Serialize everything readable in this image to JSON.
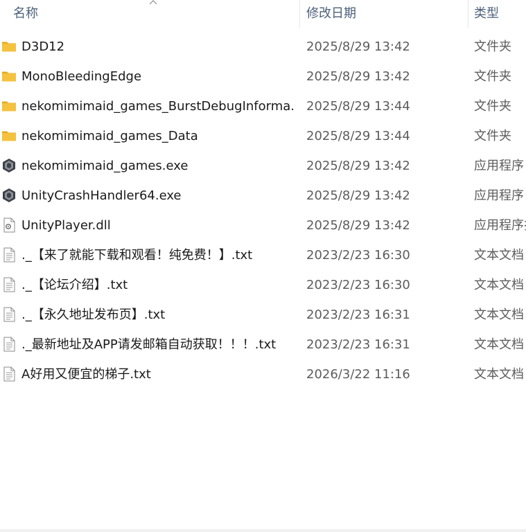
{
  "header": {
    "name_label": "名称",
    "date_label": "修改日期",
    "type_label": "类型",
    "sort_indicator": "sort-ascending-icon"
  },
  "files": [
    {
      "name": "D3D12",
      "date": "2025/8/29 13:42",
      "type": "文件夹",
      "icon": "folder-icon"
    },
    {
      "name": "MonoBleedingEdge",
      "date": "2025/8/29 13:42",
      "type": "文件夹",
      "icon": "folder-icon"
    },
    {
      "name": "nekomimimaid_games_BurstDebugInforma...",
      "date": "2025/8/29 13:44",
      "type": "文件夹",
      "icon": "folder-icon"
    },
    {
      "name": "nekomimimaid_games_Data",
      "date": "2025/8/29 13:44",
      "type": "文件夹",
      "icon": "folder-icon"
    },
    {
      "name": "nekomimimaid_games.exe",
      "date": "2025/8/29 13:42",
      "type": "应用程序",
      "icon": "unity-app-icon"
    },
    {
      "name": "UnityCrashHandler64.exe",
      "date": "2025/8/29 13:42",
      "type": "应用程序",
      "icon": "unity-app-icon"
    },
    {
      "name": "UnityPlayer.dll",
      "date": "2025/8/29 13:42",
      "type": "应用程序扩",
      "icon": "dll-file-icon"
    },
    {
      "name": "._【来了就能下载和观看！纯免费！】.txt",
      "date": "2023/2/23 16:30",
      "type": "文本文档",
      "icon": "text-file-icon"
    },
    {
      "name": "._【论坛介绍】.txt",
      "date": "2023/2/23 16:30",
      "type": "文本文档",
      "icon": "text-file-icon"
    },
    {
      "name": "._【永久地址发布页】.txt",
      "date": "2023/2/23 16:31",
      "type": "文本文档",
      "icon": "text-file-icon"
    },
    {
      "name": "._最新地址及APP请发邮箱自动获取！！！.txt",
      "date": "2023/2/23 16:31",
      "type": "文本文档",
      "icon": "text-file-icon"
    },
    {
      "name": "A好用又便宜的梯子.txt",
      "date": "2026/3/22 11:16",
      "type": "文本文档",
      "icon": "text-file-icon"
    }
  ],
  "colors": {
    "folder": "#f4c23e",
    "folder_tab": "#e8a91c",
    "header_text": "#4c607a",
    "date_text": "#5c5c5c"
  }
}
